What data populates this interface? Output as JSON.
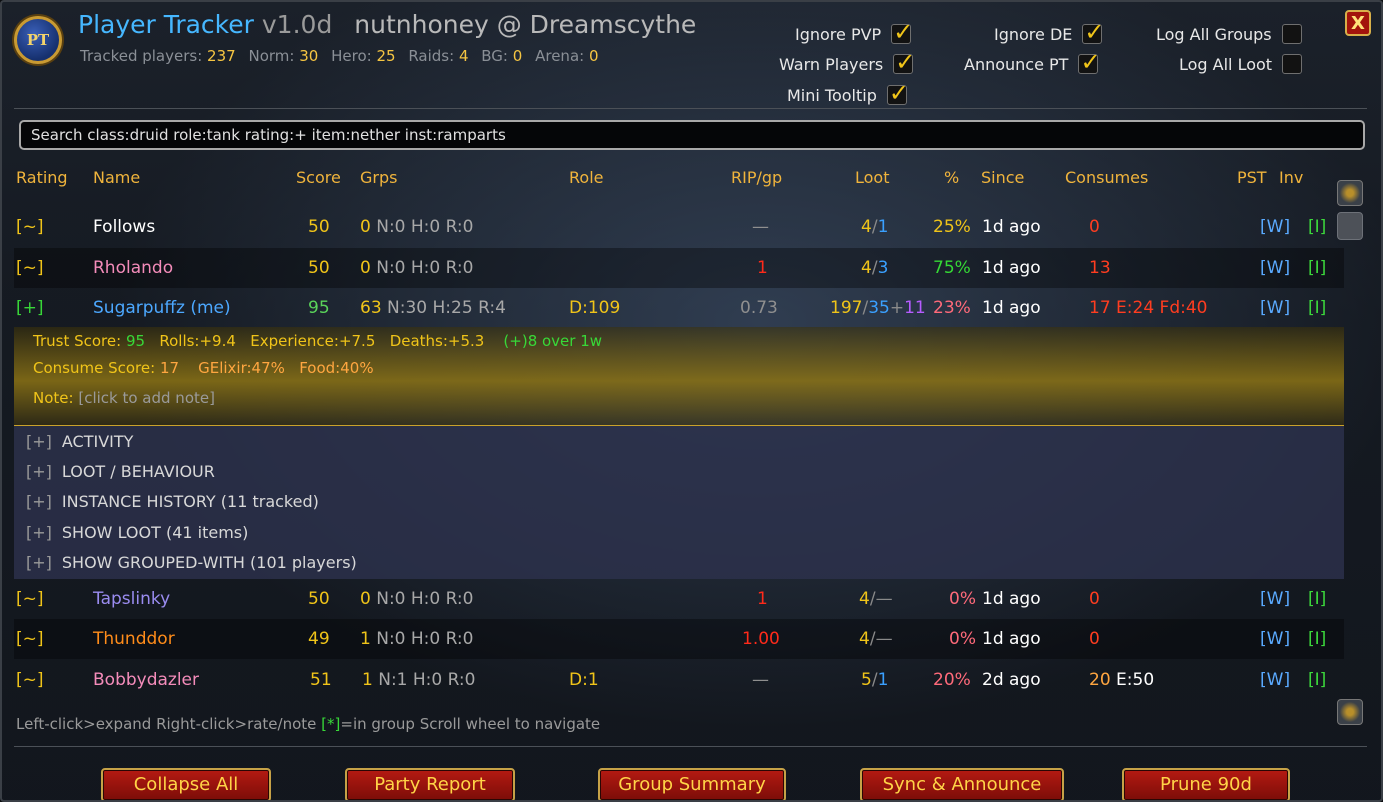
{
  "header": {
    "logo_text": "PT",
    "title": "Player Tracker",
    "version": "v1.0d",
    "account": "nutnhoney @ Dreamscythe",
    "stats": [
      {
        "label": "Tracked players:",
        "value": "237"
      },
      {
        "label": "Norm:",
        "value": "30"
      },
      {
        "label": "Hero:",
        "value": "25"
      },
      {
        "label": "Raids:",
        "value": "4"
      },
      {
        "label": "BG:",
        "value": "0"
      },
      {
        "label": "Arena:",
        "value": "0"
      }
    ]
  },
  "options": {
    "ignore_pvp": {
      "label": "Ignore PVP",
      "checked": true
    },
    "warn_players": {
      "label": "Warn Players",
      "checked": true
    },
    "mini_tooltip": {
      "label": "Mini Tooltip",
      "checked": true
    },
    "ignore_de": {
      "label": "Ignore DE",
      "checked": true
    },
    "announce_pt": {
      "label": "Announce PT",
      "checked": true
    },
    "log_all_groups": {
      "label": "Log All Groups",
      "checked": false
    },
    "log_all_loot": {
      "label": "Log All Loot",
      "checked": false
    }
  },
  "close_label": "X",
  "search": {
    "value": "Search  class:druid  role:tank  rating:+  item:nether  inst:ramparts"
  },
  "columns": {
    "rating": "Rating",
    "name": "Name",
    "score": "Score",
    "grps": "Grps",
    "role": "Role",
    "rip": "RIP/gp",
    "loot": "Loot",
    "pct": "%",
    "since": "Since",
    "consumes": "Consumes",
    "pst": "PST",
    "inv": "Inv"
  },
  "rows_top": [
    {
      "rating": "[~]",
      "name": "Follows",
      "name_color": "#ffffff",
      "score": "50",
      "grps": "0",
      "grps_sub": "N:0 H:0 R:0",
      "role": "",
      "rip": "—",
      "loot_a": "4",
      "loot_b": "1",
      "loot_c": "",
      "pct": "25%",
      "since": "1d ago",
      "cons": "0",
      "cons_extra": "",
      "pst": "[W]",
      "inv": "[I]"
    },
    {
      "rating": "[~]",
      "name": "Rholando",
      "name_color": "#f48cba",
      "score": "50",
      "grps": "0",
      "grps_sub": "N:0 H:0 R:0",
      "role": "",
      "rip": "1",
      "loot_a": "4",
      "loot_b": "3",
      "loot_c": "",
      "pct": "75%",
      "since": "1d ago",
      "cons": "13",
      "cons_extra": "",
      "pst": "[W]",
      "inv": "[I]"
    },
    {
      "rating": "[+]",
      "name": "Sugarpuffz (me)",
      "name_color": "#4ca8ff",
      "score": "95",
      "grps": "63",
      "grps_sub": "N:30 H:25 R:4",
      "role": "D:109",
      "rip": "0.73",
      "loot_a": "197",
      "loot_b": "35",
      "loot_c": "11",
      "pct": "23%",
      "since": "1d ago",
      "cons": "17",
      "cons_extra": "E:24 Fd:40",
      "pst": "[W]",
      "inv": "[I]"
    }
  ],
  "detail": {
    "trust_label": "Trust Score:",
    "trust_value": "95",
    "rolls": "Rolls:+9.4",
    "experience": "Experience:+7.5",
    "deaths": "Deaths:+5.3",
    "trend": "(+)8 over 1w",
    "consume_label": "Consume Score:",
    "consume_value": "17",
    "gelixir": "GElixir:47%",
    "food": "Food:40%",
    "note_label": "Note:",
    "note_value": "[click to add note]",
    "sections": [
      {
        "bracket": "[+]",
        "label": "ACTIVITY"
      },
      {
        "bracket": "[+]",
        "label": "LOOT / BEHAVIOUR"
      },
      {
        "bracket": "[+]",
        "label": "INSTANCE HISTORY (11 tracked)"
      },
      {
        "bracket": "[+]",
        "label": "SHOW LOOT (41 items)"
      },
      {
        "bracket": "[+]",
        "label": "SHOW GROUPED-WITH (101 players)"
      }
    ]
  },
  "rows_bottom": [
    {
      "rating": "[~]",
      "name": "Tapslinky",
      "name_color": "#9a8cf0",
      "score": "50",
      "grps": "0",
      "grps_sub": "N:0 H:0 R:0",
      "role": "",
      "rip": "1",
      "loot_a": "4",
      "loot_b": "—",
      "loot_c": "",
      "pct": "0%",
      "since": "1d ago",
      "cons": "0",
      "cons_extra": "",
      "pst": "[W]",
      "inv": "[I]"
    },
    {
      "rating": "[~]",
      "name": "Thunddor",
      "name_color": "#ff8c1a",
      "score": "49",
      "grps": "1",
      "grps_sub": "N:0 H:0 R:0",
      "role": "",
      "rip": "1.00",
      "loot_a": "4",
      "loot_b": "—",
      "loot_c": "",
      "pct": "0%",
      "since": "1d ago",
      "cons": "0",
      "cons_extra": "",
      "pst": "[W]",
      "inv": "[I]"
    },
    {
      "rating": "[~]",
      "name": "Bobbydazler",
      "name_color": "#f48cba",
      "score": "51",
      "grps": "1",
      "grps_sub": "N:1 H:0 R:0",
      "role": "D:1",
      "rip": "—",
      "loot_a": "5",
      "loot_b": "1",
      "loot_c": "",
      "pct": "20%",
      "since": "2d ago",
      "cons": "20",
      "cons_extra": "E:50",
      "pst": "[W]",
      "inv": "[I]"
    }
  ],
  "help": {
    "text1": "Left-click>expand  Right-click>rate/note  ",
    "text2": "[*]",
    "text3": "=in group  Scroll wheel to navigate"
  },
  "buttons": {
    "collapse_all": "Collapse All",
    "party_report": "Party Report",
    "group_summary": "Group Summary",
    "sync_announce": "Sync & Announce",
    "prune": "Prune 90d"
  }
}
